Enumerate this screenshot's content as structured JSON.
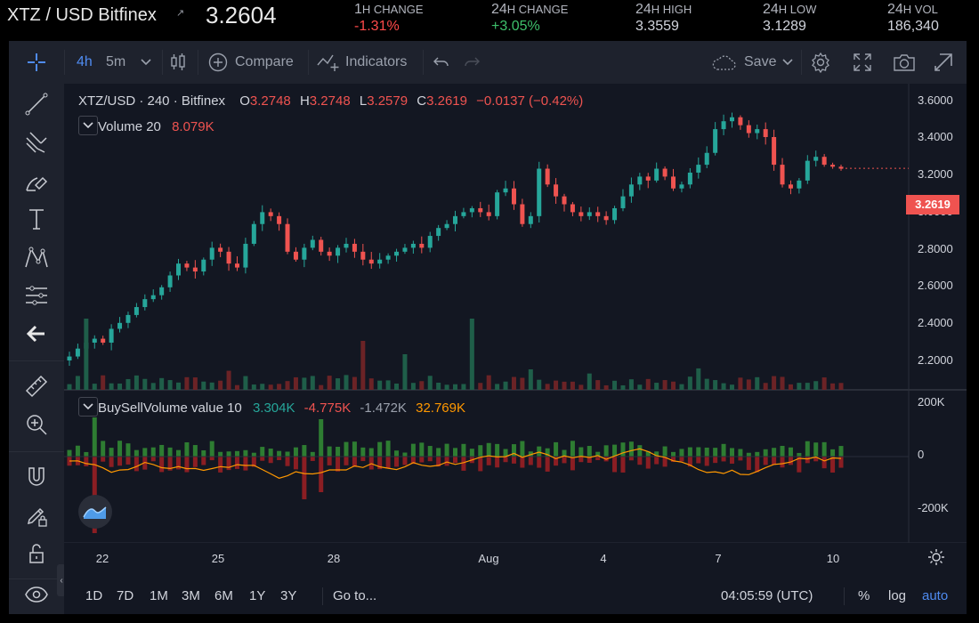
{
  "ticker": {
    "symbol": "XTZ / USD Bitfinex",
    "price": "3.2604",
    "stats": [
      {
        "pre": "1",
        "post": "H CHANGE",
        "value": "-1.31%",
        "tone": "neg"
      },
      {
        "pre": "24",
        "post": "H CHANGE",
        "value": "+3.05%",
        "tone": "pos"
      },
      {
        "pre": "24",
        "post": "H HIGH",
        "value": "3.3559",
        "tone": "neu"
      },
      {
        "pre": "24",
        "post": "H LOW",
        "value": "3.1289",
        "tone": "neu"
      },
      {
        "pre": "24",
        "post": "H VOL",
        "value": "186,340",
        "tone": "neu"
      }
    ]
  },
  "toolbar": {
    "interval_1": "4h",
    "interval_2": "5m",
    "compare": "Compare",
    "indicators": "Indicators",
    "save": "Save"
  },
  "legend": {
    "symbol": "XTZ/USD · 240 · Bitfinex",
    "o_label": "O",
    "o": "3.2748",
    "h_label": "H",
    "h": "3.2748",
    "l_label": "L",
    "l": "3.2579",
    "c_label": "C",
    "c": "3.2619",
    "change": "−0.0137 (−0.42%)",
    "volume_label": "Volume 20",
    "volume_value": "8.079K",
    "bsv_label": "BuySellVolume value 10",
    "bsv_v1": "3.304K",
    "bsv_v2": "-4.775K",
    "bsv_v3": "-1.472K",
    "bsv_v4": "32.769K"
  },
  "price_axis": [
    "3.6000",
    "3.4000",
    "3.2000",
    "3.0000",
    "2.8000",
    "2.6000",
    "2.4000",
    "2.2000"
  ],
  "last_price_label": "3.2619",
  "volume_axis": [
    "200K",
    "0",
    "-200K"
  ],
  "time_axis": [
    "22",
    "25",
    "28",
    "Aug",
    "4",
    "7",
    "10"
  ],
  "bottom": {
    "ranges": [
      "1D",
      "7D",
      "1M",
      "3M",
      "6M",
      "1Y",
      "3Y"
    ],
    "goto": "Go to...",
    "time": "04:05:59 (UTC)",
    "percent": "%",
    "log": "log",
    "auto": "auto"
  },
  "colors": {
    "up": "#26a69a",
    "down": "#ef5350",
    "line": "#ff9800",
    "grid": "#2a2e39"
  },
  "chart_data": {
    "type": "candlestick",
    "title": "XTZ/USD · 240 · Bitfinex",
    "ylim": [
      2.1,
      3.7
    ],
    "x_ticks": [
      "22",
      "25",
      "28",
      "Aug",
      "4",
      "7",
      "10"
    ],
    "close_path": [
      2.31,
      2.35,
      2.38,
      2.4,
      2.38,
      2.45,
      2.48,
      2.52,
      2.56,
      2.6,
      2.62,
      2.66,
      2.72,
      2.78,
      2.76,
      2.74,
      2.8,
      2.86,
      2.84,
      2.78,
      2.76,
      2.88,
      2.98,
      3.04,
      3.02,
      2.98,
      2.84,
      2.8,
      2.86,
      2.9,
      2.84,
      2.82,
      2.86,
      2.88,
      2.84,
      2.8,
      2.78,
      2.8,
      2.82,
      2.84,
      2.86,
      2.88,
      2.86,
      2.92,
      2.96,
      2.98,
      3.02,
      3.04,
      3.06,
      3.04,
      3.02,
      3.14,
      3.16,
      3.08,
      2.98,
      3.02,
      3.26,
      3.18,
      3.12,
      3.08,
      3.04,
      3.02,
      3.04,
      3.02,
      3.0,
      3.06,
      3.12,
      3.18,
      3.22,
      3.2,
      3.26,
      3.22,
      3.16,
      3.18,
      3.24,
      3.28,
      3.34,
      3.46,
      3.5,
      3.52,
      3.48,
      3.44,
      3.46,
      3.42,
      3.28,
      3.18,
      3.16,
      3.2,
      3.3,
      3.32,
      3.28,
      3.27,
      3.26
    ]
  }
}
